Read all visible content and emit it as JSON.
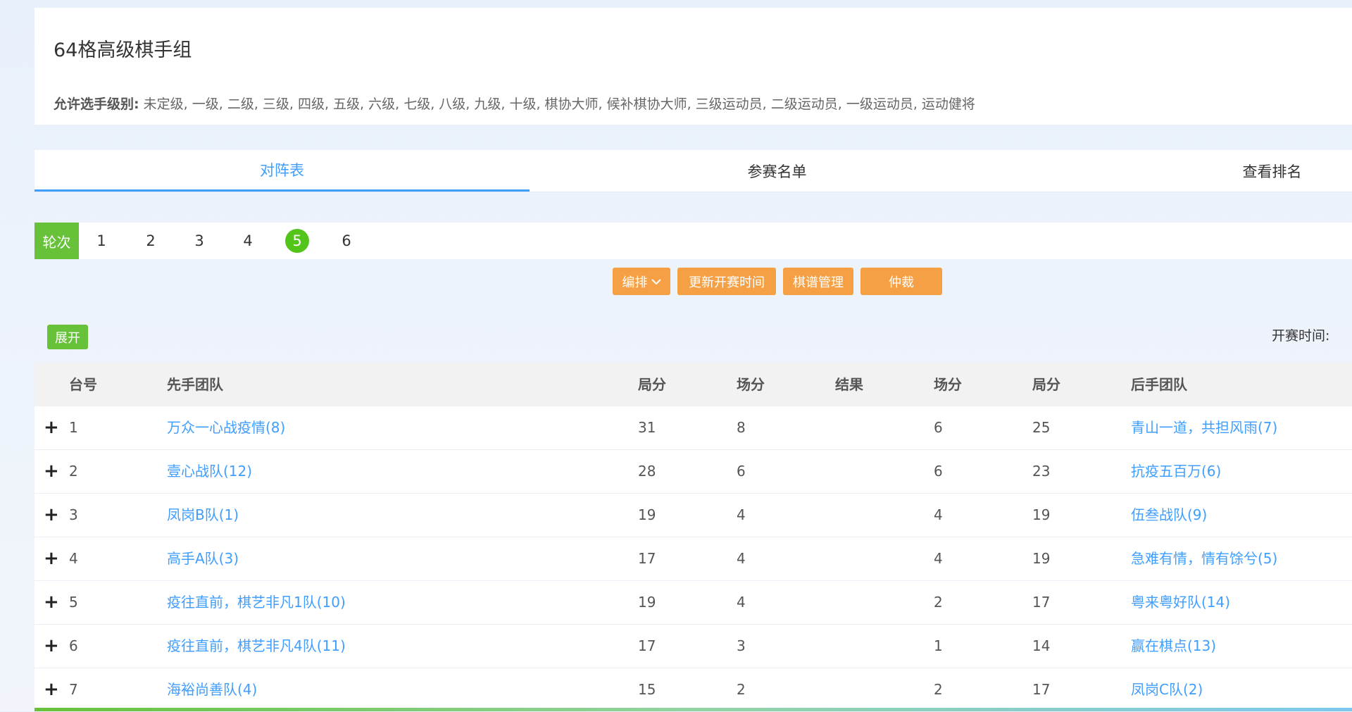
{
  "header": {
    "title": "64格高级棋手组",
    "allowed_label": "允许选手级别:",
    "allowed_levels": "未定级, 一级, 二级, 三级, 四级, 五级, 六级, 七级, 八级, 九级, 十级, 棋协大师, 候补棋协大师, 三级运动员, 二级运动员, 一级运动员, 运动健将"
  },
  "tabs": [
    {
      "label": "对阵表",
      "active": true
    },
    {
      "label": "参赛名单",
      "active": false
    },
    {
      "label": "查看排名",
      "active": false
    }
  ],
  "rounds": {
    "label": "轮次",
    "items": [
      "1",
      "2",
      "3",
      "4",
      "5",
      "6"
    ],
    "active": "5"
  },
  "actions": {
    "arrange": "编排",
    "arrange_icon": "chevron-down-icon",
    "update_time": "更新开赛时间",
    "record_manage": "棋谱管理",
    "referee": "仲裁"
  },
  "expand_label": "展开",
  "start_time_label": "开赛时间:",
  "table": {
    "headers": {
      "board": "台号",
      "first_team": "先手团队",
      "first_game_pts": "局分",
      "first_match_pts": "场分",
      "result": "结果",
      "second_match_pts": "场分",
      "second_game_pts": "局分",
      "second_team": "后手团队"
    },
    "rows": [
      {
        "board": "1",
        "first_team": "万众一心战疫情(8)",
        "first_game_pts": "31",
        "first_match_pts": "8",
        "result": "",
        "second_match_pts": "6",
        "second_game_pts": "25",
        "second_team": "青山一道，共担风雨(7)"
      },
      {
        "board": "2",
        "first_team": "壹心战队(12)",
        "first_game_pts": "28",
        "first_match_pts": "6",
        "result": "",
        "second_match_pts": "6",
        "second_game_pts": "23",
        "second_team": "抗疫五百万(6)"
      },
      {
        "board": "3",
        "first_team": "凤岗B队(1)",
        "first_game_pts": "19",
        "first_match_pts": "4",
        "result": "",
        "second_match_pts": "4",
        "second_game_pts": "19",
        "second_team": "伍叁战队(9)"
      },
      {
        "board": "4",
        "first_team": "高手A队(3)",
        "first_game_pts": "17",
        "first_match_pts": "4",
        "result": "",
        "second_match_pts": "4",
        "second_game_pts": "19",
        "second_team": "急难有情，情有馀兮(5)"
      },
      {
        "board": "5",
        "first_team": "疫往直前，棋艺非凡1队(10)",
        "first_game_pts": "19",
        "first_match_pts": "4",
        "result": "",
        "second_match_pts": "2",
        "second_game_pts": "17",
        "second_team": "粤来粤好队(14)"
      },
      {
        "board": "6",
        "first_team": "疫往直前，棋艺非凡4队(11)",
        "first_game_pts": "17",
        "first_match_pts": "3",
        "result": "",
        "second_match_pts": "1",
        "second_game_pts": "14",
        "second_team": "赢在棋点(13)"
      },
      {
        "board": "7",
        "first_team": "海裕尚善队(4)",
        "first_game_pts": "15",
        "first_match_pts": "2",
        "result": "",
        "second_match_pts": "2",
        "second_game_pts": "17",
        "second_team": "凤岗C队(2)"
      }
    ]
  },
  "colors": {
    "accent_blue": "#409eff",
    "green": "#67c23a",
    "round_active": "#52c41a",
    "orange": "#f5a045"
  }
}
